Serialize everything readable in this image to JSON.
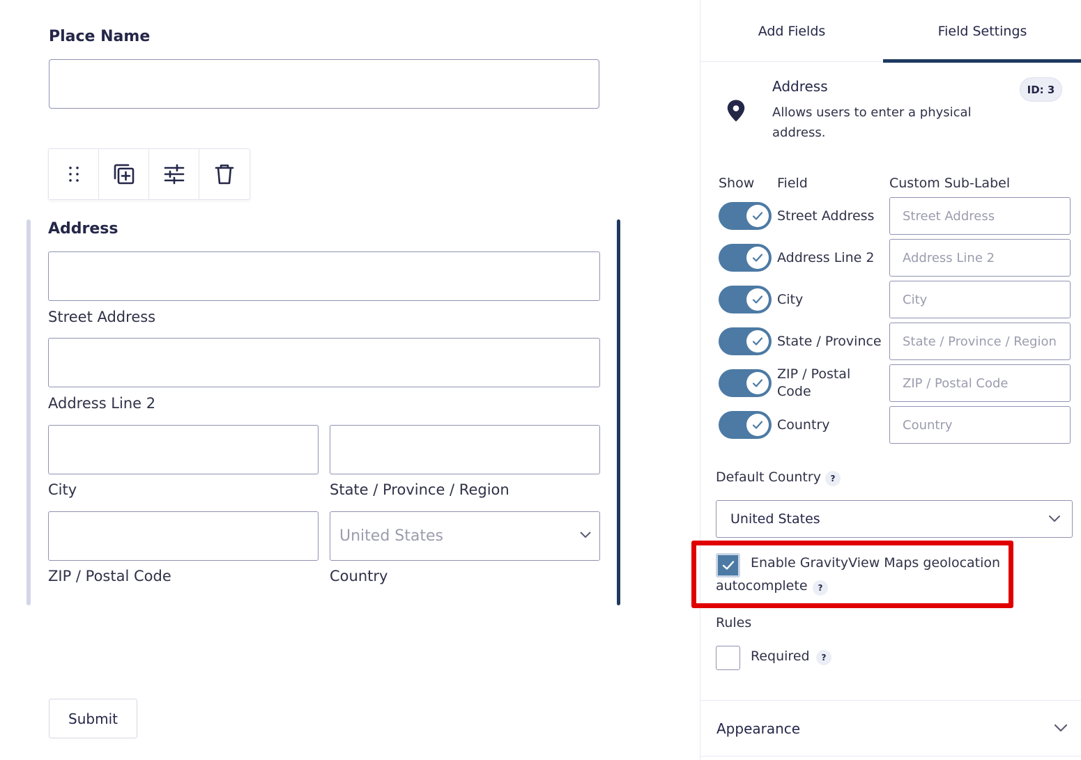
{
  "canvas": {
    "place_name_label": "Place Name",
    "address_label": "Address",
    "sub_labels": {
      "street": "Street Address",
      "line2": "Address Line 2",
      "city": "City",
      "state": "State / Province / Region",
      "zip": "ZIP / Postal Code",
      "country": "Country"
    },
    "country_select_value": "United States",
    "submit_label": "Submit"
  },
  "sidebar": {
    "tabs": [
      {
        "label": "Add Fields",
        "active": false
      },
      {
        "label": "Field Settings",
        "active": true
      }
    ],
    "field_info": {
      "icon": "map-pin-icon",
      "title": "Address",
      "description": "Allows users to enter a physical address.",
      "id_badge": "ID: 3"
    },
    "columns": {
      "show": "Show",
      "field": "Field",
      "custom": "Custom Sub-Label"
    },
    "rows": [
      {
        "field": "Street Address",
        "placeholder": "Street Address",
        "enabled": true
      },
      {
        "field": "Address Line 2",
        "placeholder": "Address Line 2",
        "enabled": true
      },
      {
        "field": "City",
        "placeholder": "City",
        "enabled": true
      },
      {
        "field": "State / Province",
        "placeholder": "State / Province / Region",
        "enabled": true
      },
      {
        "field": "ZIP / Postal Code",
        "placeholder": "ZIP / Postal Code",
        "enabled": true
      },
      {
        "field": "Country",
        "placeholder": "Country",
        "enabled": true
      }
    ],
    "default_country_label": "Default Country",
    "default_country_value": "United States",
    "geo": {
      "label_line1": "Enable GravityView Maps geolocation",
      "label_line2": "autocomplete",
      "checked": true
    },
    "rules_label": "Rules",
    "required_label": "Required",
    "required_checked": false,
    "help_glyph": "?",
    "appearance_label": "Appearance"
  },
  "colors": {
    "accent": "#4c7aa4",
    "navy": "#1f3a60",
    "highlight": "#e00000",
    "text": "#242748"
  }
}
